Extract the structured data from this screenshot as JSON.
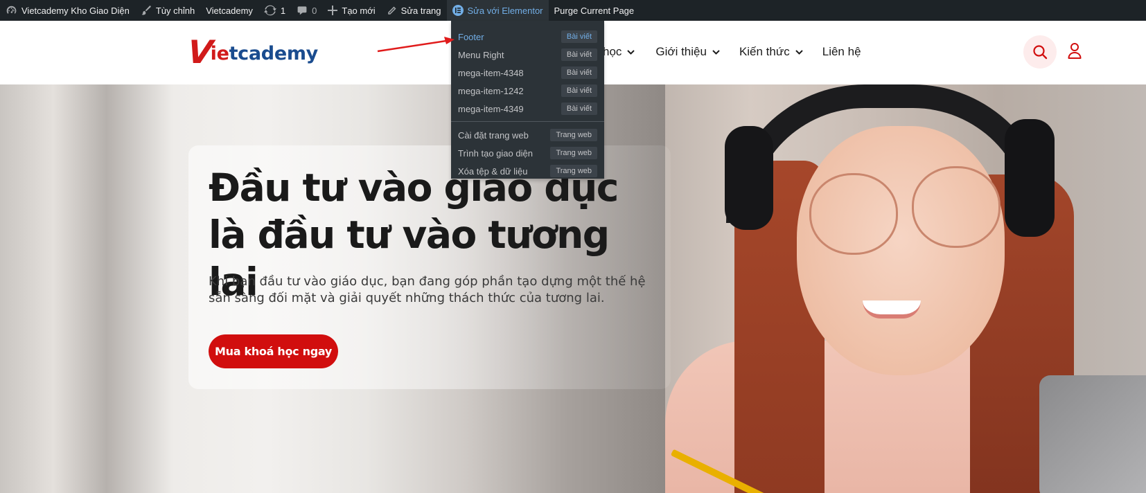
{
  "adminbar": {
    "site_name": "Vietcademy Kho Giao Diện",
    "customize": "Tùy chỉnh",
    "site_link": "Vietcademy",
    "updates_count": "1",
    "comments_count": "0",
    "new_label": "Tạo mới",
    "edit_page": "Sửa trang",
    "edit_elementor": "Sửa với Elementor",
    "purge": "Purge Current Page"
  },
  "dropdown": {
    "items": [
      {
        "label": "Footer",
        "tag": "Bài viết"
      },
      {
        "label": "Menu Right",
        "tag": "Bài viết"
      },
      {
        "label": "mega-item-4348",
        "tag": "Bài viết"
      },
      {
        "label": "mega-item-1242",
        "tag": "Bài viết"
      },
      {
        "label": "mega-item-4349",
        "tag": "Bài viết"
      }
    ],
    "site_items": [
      {
        "label": "Cài đặt trang web",
        "tag": "Trang web"
      },
      {
        "label": "Trình tạo giao diện",
        "tag": "Trang web"
      },
      {
        "label": "Xóa tệp & dữ liệu",
        "tag": "Trang web"
      }
    ]
  },
  "header": {
    "logo_v": "V",
    "logo_ie": "ie",
    "logo_rest": "tcademy",
    "nav": [
      {
        "label": "học"
      },
      {
        "label": "Giới thiệu"
      },
      {
        "label": "Kiến thức"
      },
      {
        "label": "Liên hệ"
      }
    ]
  },
  "hero": {
    "title": "Đầu tư vào giáo dục là đầu tư vào tương lai",
    "subtitle": "Khi bạn đầu tư vào giáo dục, bạn đang góp phần tạo dựng một thế hệ sẵn sàng đối mặt và giải quyết những thách thức của tương lai.",
    "cta": "Mua khoá học ngay"
  },
  "colors": {
    "brand_red": "#d10e0e",
    "brand_blue": "#1a4c8f",
    "adminbar_bg": "#1d2327",
    "link_blue": "#72aee6"
  }
}
